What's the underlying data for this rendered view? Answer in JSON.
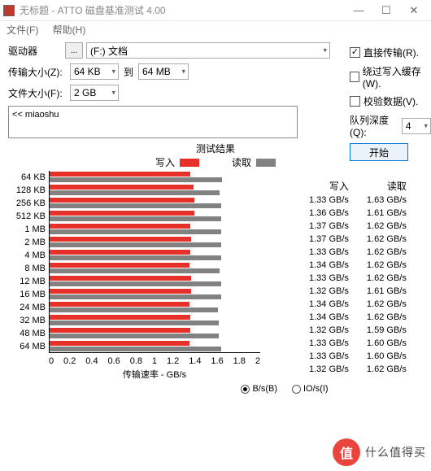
{
  "window": {
    "title": "无标题 - ATTO 磁盘基准测试 4.00",
    "min": "—",
    "max": "☐",
    "close": "✕"
  },
  "menu": {
    "file": "文件(F)",
    "help": "帮助(H)"
  },
  "form": {
    "drive_lbl": "驱动器",
    "browse": "...",
    "drive_val": "(F:) 文档",
    "ts_lbl": "传输大小(Z):",
    "ts_from": "64 KB",
    "to": "到",
    "ts_to": "64 MB",
    "fs_lbl": "文件大小(F):",
    "fs_val": "2 GB",
    "direct": "直接传输(R).",
    "bypass": "绕过写入缓存(W).",
    "verify": "校验数据(V).",
    "qd_lbl": "队列深度(Q):",
    "qd_val": "4",
    "start": "开始",
    "path": "<< miaoshu"
  },
  "chart_data": {
    "type": "bar",
    "title": "测试结果",
    "legend_write": "写入",
    "legend_read": "读取",
    "xlabel": "传输速率 - GB/s",
    "xlim": [
      0,
      2
    ],
    "xticks": [
      "0",
      "0.2",
      "0.4",
      "0.6",
      "0.8",
      "1",
      "1.2",
      "1.4",
      "1.6",
      "1.8",
      "2"
    ],
    "categories": [
      "64 KB",
      "128 KB",
      "256 KB",
      "512 KB",
      "1 MB",
      "2 MB",
      "4 MB",
      "8 MB",
      "12 MB",
      "16 MB",
      "24 MB",
      "32 MB",
      "48 MB",
      "64 MB"
    ],
    "series": [
      {
        "name": "写入",
        "values": [
          1.33,
          1.36,
          1.37,
          1.37,
          1.33,
          1.34,
          1.33,
          1.32,
          1.34,
          1.34,
          1.32,
          1.33,
          1.33,
          1.32
        ],
        "unit": "GB/s"
      },
      {
        "name": "读取",
        "values": [
          1.63,
          1.61,
          1.62,
          1.62,
          1.62,
          1.62,
          1.62,
          1.61,
          1.62,
          1.62,
          1.59,
          1.6,
          1.6,
          1.62
        ],
        "unit": "GB/s"
      }
    ]
  },
  "cols": {
    "write_hdr": "写入",
    "read_hdr": "读取"
  },
  "radio": {
    "bs": "B/s(B)",
    "ios": "IO/s(I)"
  },
  "watermark": {
    "badge": "值",
    "text": "什么值得买"
  }
}
